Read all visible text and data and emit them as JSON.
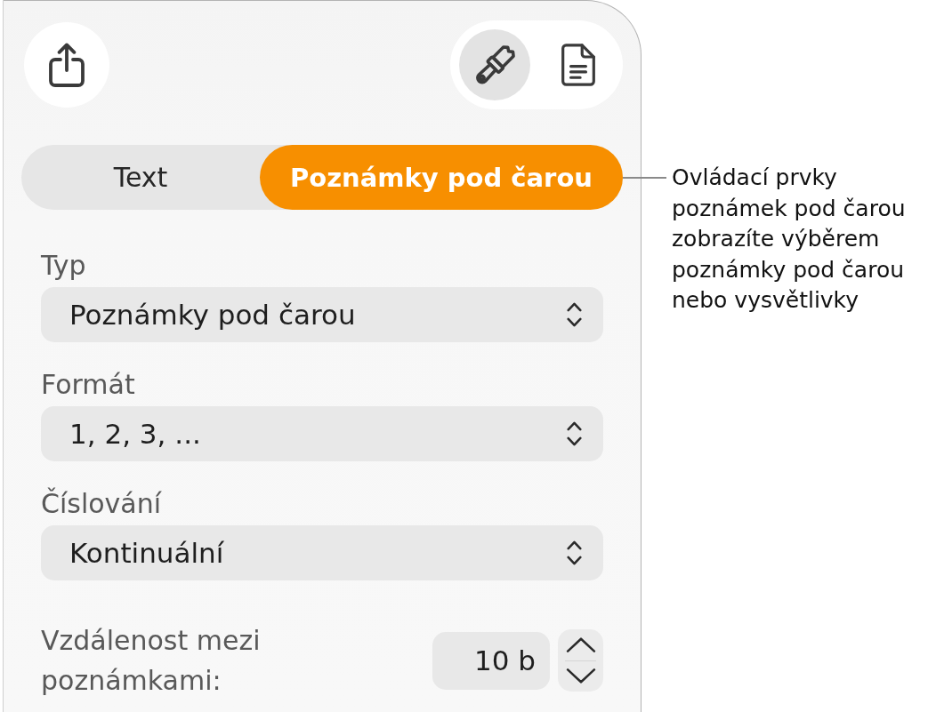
{
  "toolbar": {
    "inspector_buttons": [
      {
        "kind": "format",
        "selected": true
      },
      {
        "kind": "document",
        "selected": false
      }
    ]
  },
  "tabs": [
    {
      "label": "Text",
      "selected": false
    },
    {
      "label": "Poznámky pod čarou",
      "selected": true
    }
  ],
  "fields": [
    {
      "label": "Typ",
      "value": "Poznámky pod čarou"
    },
    {
      "label": "Formát",
      "value": "1, 2, 3, ..."
    },
    {
      "label": "Číslování",
      "value": "Kontinuální"
    }
  ],
  "spacing": {
    "label": "Vzdálenost mezi poznámkami:",
    "value": "10 b"
  },
  "callout": {
    "text": "Ovládací prvky\npoznámek pod čarou\nzobrazíte výběrem\npoznámky pod čarou\nnebo vysvětlivky"
  }
}
